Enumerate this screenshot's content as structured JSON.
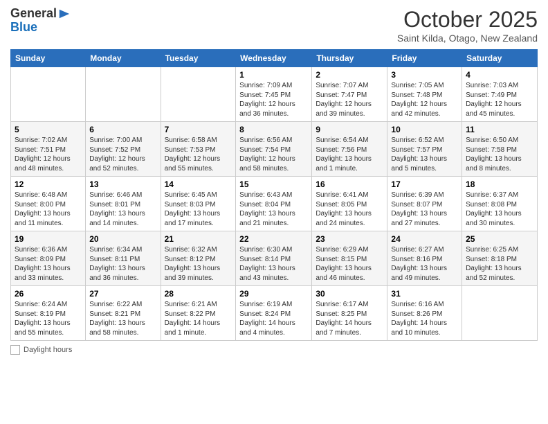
{
  "header": {
    "logo_line1": "General",
    "logo_line2": "Blue",
    "month": "October 2025",
    "location": "Saint Kilda, Otago, New Zealand"
  },
  "days_of_week": [
    "Sunday",
    "Monday",
    "Tuesday",
    "Wednesday",
    "Thursday",
    "Friday",
    "Saturday"
  ],
  "weeks": [
    [
      {
        "day": "",
        "info": ""
      },
      {
        "day": "",
        "info": ""
      },
      {
        "day": "",
        "info": ""
      },
      {
        "day": "1",
        "info": "Sunrise: 7:09 AM\nSunset: 7:45 PM\nDaylight: 12 hours and 36 minutes."
      },
      {
        "day": "2",
        "info": "Sunrise: 7:07 AM\nSunset: 7:47 PM\nDaylight: 12 hours and 39 minutes."
      },
      {
        "day": "3",
        "info": "Sunrise: 7:05 AM\nSunset: 7:48 PM\nDaylight: 12 hours and 42 minutes."
      },
      {
        "day": "4",
        "info": "Sunrise: 7:03 AM\nSunset: 7:49 PM\nDaylight: 12 hours and 45 minutes."
      }
    ],
    [
      {
        "day": "5",
        "info": "Sunrise: 7:02 AM\nSunset: 7:51 PM\nDaylight: 12 hours and 48 minutes."
      },
      {
        "day": "6",
        "info": "Sunrise: 7:00 AM\nSunset: 7:52 PM\nDaylight: 12 hours and 52 minutes."
      },
      {
        "day": "7",
        "info": "Sunrise: 6:58 AM\nSunset: 7:53 PM\nDaylight: 12 hours and 55 minutes."
      },
      {
        "day": "8",
        "info": "Sunrise: 6:56 AM\nSunset: 7:54 PM\nDaylight: 12 hours and 58 minutes."
      },
      {
        "day": "9",
        "info": "Sunrise: 6:54 AM\nSunset: 7:56 PM\nDaylight: 13 hours and 1 minute."
      },
      {
        "day": "10",
        "info": "Sunrise: 6:52 AM\nSunset: 7:57 PM\nDaylight: 13 hours and 5 minutes."
      },
      {
        "day": "11",
        "info": "Sunrise: 6:50 AM\nSunset: 7:58 PM\nDaylight: 13 hours and 8 minutes."
      }
    ],
    [
      {
        "day": "12",
        "info": "Sunrise: 6:48 AM\nSunset: 8:00 PM\nDaylight: 13 hours and 11 minutes."
      },
      {
        "day": "13",
        "info": "Sunrise: 6:46 AM\nSunset: 8:01 PM\nDaylight: 13 hours and 14 minutes."
      },
      {
        "day": "14",
        "info": "Sunrise: 6:45 AM\nSunset: 8:03 PM\nDaylight: 13 hours and 17 minutes."
      },
      {
        "day": "15",
        "info": "Sunrise: 6:43 AM\nSunset: 8:04 PM\nDaylight: 13 hours and 21 minutes."
      },
      {
        "day": "16",
        "info": "Sunrise: 6:41 AM\nSunset: 8:05 PM\nDaylight: 13 hours and 24 minutes."
      },
      {
        "day": "17",
        "info": "Sunrise: 6:39 AM\nSunset: 8:07 PM\nDaylight: 13 hours and 27 minutes."
      },
      {
        "day": "18",
        "info": "Sunrise: 6:37 AM\nSunset: 8:08 PM\nDaylight: 13 hours and 30 minutes."
      }
    ],
    [
      {
        "day": "19",
        "info": "Sunrise: 6:36 AM\nSunset: 8:09 PM\nDaylight: 13 hours and 33 minutes."
      },
      {
        "day": "20",
        "info": "Sunrise: 6:34 AM\nSunset: 8:11 PM\nDaylight: 13 hours and 36 minutes."
      },
      {
        "day": "21",
        "info": "Sunrise: 6:32 AM\nSunset: 8:12 PM\nDaylight: 13 hours and 39 minutes."
      },
      {
        "day": "22",
        "info": "Sunrise: 6:30 AM\nSunset: 8:14 PM\nDaylight: 13 hours and 43 minutes."
      },
      {
        "day": "23",
        "info": "Sunrise: 6:29 AM\nSunset: 8:15 PM\nDaylight: 13 hours and 46 minutes."
      },
      {
        "day": "24",
        "info": "Sunrise: 6:27 AM\nSunset: 8:16 PM\nDaylight: 13 hours and 49 minutes."
      },
      {
        "day": "25",
        "info": "Sunrise: 6:25 AM\nSunset: 8:18 PM\nDaylight: 13 hours and 52 minutes."
      }
    ],
    [
      {
        "day": "26",
        "info": "Sunrise: 6:24 AM\nSunset: 8:19 PM\nDaylight: 13 hours and 55 minutes."
      },
      {
        "day": "27",
        "info": "Sunrise: 6:22 AM\nSunset: 8:21 PM\nDaylight: 13 hours and 58 minutes."
      },
      {
        "day": "28",
        "info": "Sunrise: 6:21 AM\nSunset: 8:22 PM\nDaylight: 14 hours and 1 minute."
      },
      {
        "day": "29",
        "info": "Sunrise: 6:19 AM\nSunset: 8:24 PM\nDaylight: 14 hours and 4 minutes."
      },
      {
        "day": "30",
        "info": "Sunrise: 6:17 AM\nSunset: 8:25 PM\nDaylight: 14 hours and 7 minutes."
      },
      {
        "day": "31",
        "info": "Sunrise: 6:16 AM\nSunset: 8:26 PM\nDaylight: 14 hours and 10 minutes."
      },
      {
        "day": "",
        "info": ""
      }
    ]
  ],
  "footer": {
    "daylight_label": "Daylight hours"
  }
}
